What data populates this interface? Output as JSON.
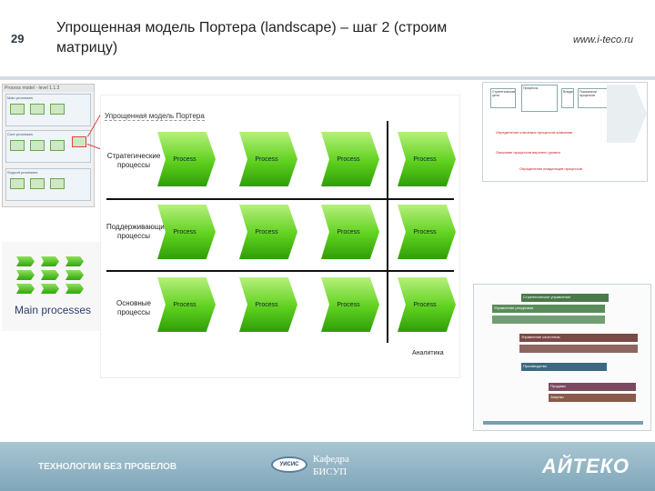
{
  "slide": {
    "number": "29",
    "title": "Упрощенная модель Портера (landscape) – шаг 2 (строим матрицу)",
    "site": "www.i-teco.ru"
  },
  "thumbnail": {
    "header": "Process model - level 1.1.3",
    "groups": [
      "Main processes",
      "Core processes",
      "Support processes"
    ]
  },
  "main_processes": {
    "label": "Main processes"
  },
  "matrix": {
    "title": "Упрощенная модель Портера",
    "rows": [
      {
        "label": "Стратегические процессы"
      },
      {
        "label": "Поддерживающие процессы"
      },
      {
        "label": "Основные процессы"
      }
    ],
    "process_label": "Process",
    "axis_label": "Аналитика"
  },
  "right_top": {
    "boxes": [
      "Стратегические цели",
      "Процессы",
      "Владелец",
      "Показатели процессов"
    ],
    "red_lines": [
      "Определение ключевых процессов компании",
      "Описание процессов верхнего уровня",
      "Определение владельцев процессов"
    ]
  },
  "right_bottom": {
    "bars": [
      {
        "label": "Стратегическое управление",
        "color": "#4a7a4a"
      },
      {
        "label": "Управление ресурсами",
        "color": "#5a8c5a"
      },
      {
        "label": "Управление качеством",
        "color": "#7a4a44"
      },
      {
        "label": "Производство",
        "color": "#3b6a80"
      },
      {
        "label": "Продажи",
        "color": "#7a4a60"
      },
      {
        "label": "Закупки",
        "color": "#8a5a4a"
      }
    ]
  },
  "footer": {
    "left_text": "ТЕХНОЛОГИИ БЕЗ ПРОБЕЛОВ",
    "dept_logo": "УИСИС",
    "dept_line1": "Кафедра",
    "dept_line2": "БИСУП",
    "brand": "АЙТЕКО"
  }
}
